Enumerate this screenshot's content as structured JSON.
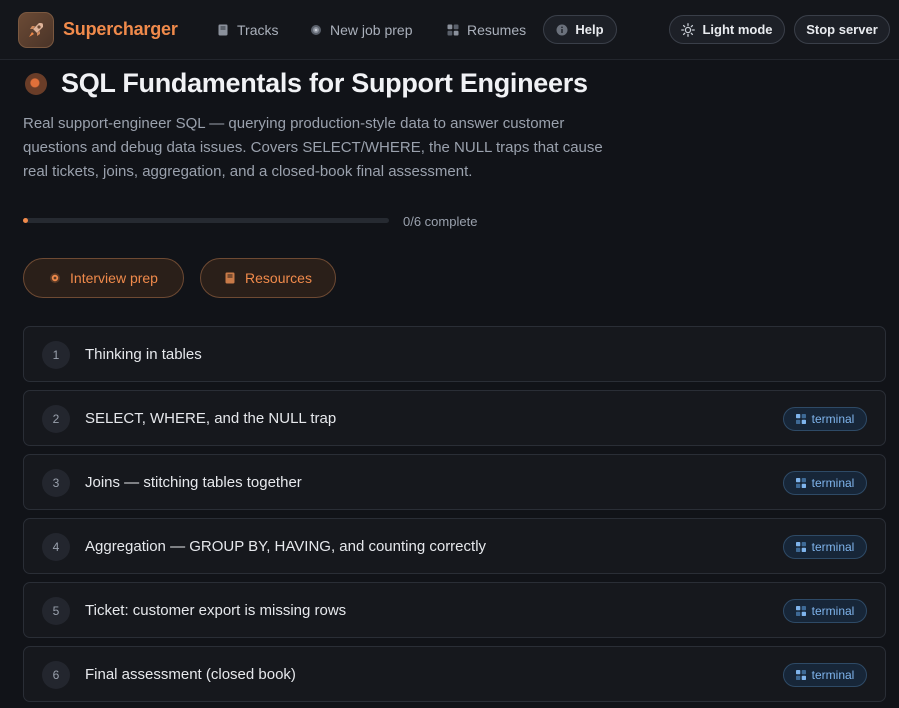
{
  "header": {
    "brand": "Supercharger",
    "nav": [
      {
        "label": "Tracks",
        "icon": "book-icon"
      },
      {
        "label": "New job prep",
        "icon": "target-icon"
      },
      {
        "label": "Resumes",
        "icon": "grid-icon"
      }
    ],
    "help_label": "Help",
    "light_mode_label": "Light mode",
    "stop_server_label": "Stop server"
  },
  "course": {
    "title": "SQL Fundamentals for Support Engineers",
    "description": "Real support-engineer SQL — querying production-style data to answer customer questions and debug data issues. Covers SELECT/WHERE, the NULL traps that cause real tickets, joins, aggregation, and a closed-book final assessment.",
    "progress": {
      "completed": 0,
      "total": 6,
      "label": "0/6 complete"
    }
  },
  "actions": {
    "interview_prep": "Interview prep",
    "resources": "Resources"
  },
  "lessons": [
    {
      "number": "1",
      "title": "Thinking in tables",
      "tag": ""
    },
    {
      "number": "2",
      "title": "SELECT, WHERE, and the NULL trap",
      "tag": "terminal"
    },
    {
      "number": "3",
      "title": "Joins — stitching tables together",
      "tag": "terminal"
    },
    {
      "number": "4",
      "title": "Aggregation — GROUP BY, HAVING, and counting correctly",
      "tag": "terminal"
    },
    {
      "number": "5",
      "title": "Ticket: customer export is missing rows",
      "tag": "terminal"
    },
    {
      "number": "6",
      "title": "Final assessment (closed book)",
      "tag": "terminal"
    }
  ],
  "colors": {
    "accent": "#f08a4b",
    "background": "#111318",
    "tag_text": "#7fb4ec"
  }
}
